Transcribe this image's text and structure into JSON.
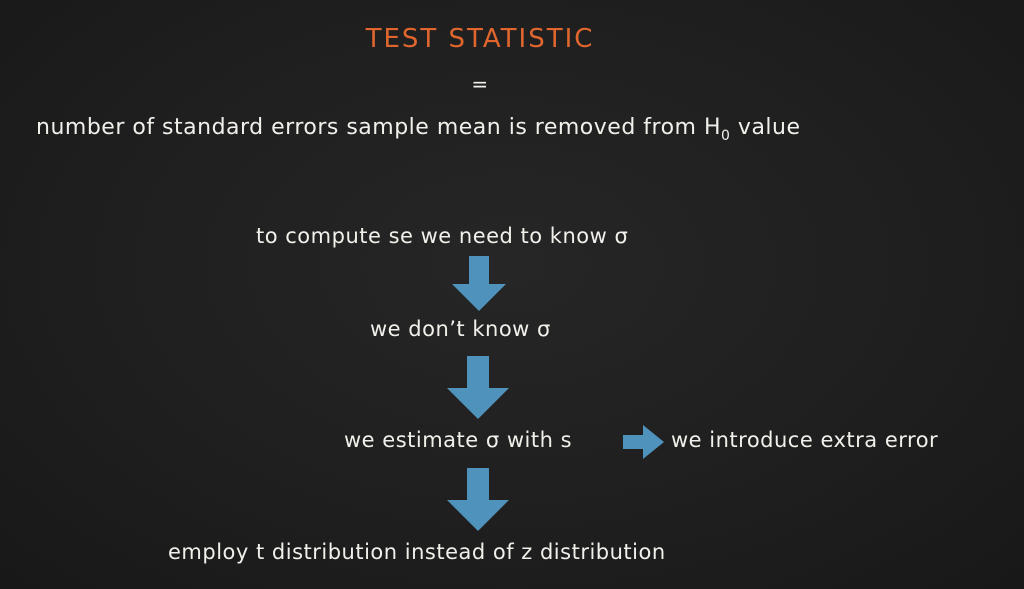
{
  "slide": {
    "title": "TEST STATISTIC",
    "equals": "=",
    "definition": {
      "text": "number of standard errors sample mean is removed from H",
      "subscript": "0",
      "suffix": " value"
    },
    "steps": [
      "to compute se we need to know σ",
      "we don’t know σ",
      "we estimate σ with s",
      "employ t distribution instead of z distribution"
    ],
    "side_note": "we introduce extra error"
  },
  "colors": {
    "background": "#1e1e1e",
    "chalk_text": "#f2f0ea",
    "title_orange": "#e0662e",
    "arrow_blue": "#4f93bd"
  },
  "icons": {
    "flow_arrow": "arrow-down-icon",
    "side_arrow": "arrow-right-icon"
  }
}
